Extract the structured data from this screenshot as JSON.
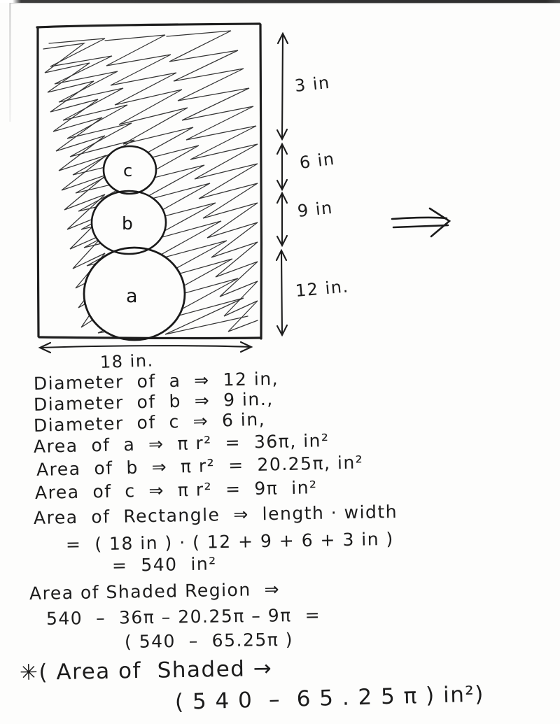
{
  "document": {
    "kind": "handwritten-geometry-worksheet",
    "ink_color": "#1c1c1c",
    "paper_color": "#fdfdfc"
  },
  "diagram": {
    "name": "shaded-rectangle-with-three-circles",
    "rectangle": {
      "label_width": "18 in.",
      "shaded": true
    },
    "circles": [
      {
        "id": "c",
        "label": "c",
        "position": "top",
        "diameter_in": 6
      },
      {
        "id": "b",
        "label": "b",
        "position": "middle",
        "diameter_in": 9
      },
      {
        "id": "a",
        "label": "a",
        "position": "bottom",
        "diameter_in": 12
      }
    ],
    "vertical_dimensions": [
      {
        "label": "3 in",
        "segment": "top-gap"
      },
      {
        "label": "6 in",
        "segment": "circle-c"
      },
      {
        "label": "9 in",
        "segment": "circle-b"
      },
      {
        "label": "12 in.",
        "segment": "circle-a"
      }
    ],
    "side_arrow": "⇒"
  },
  "work": {
    "lines": [
      {
        "id": "diam-a",
        "text": "Diameter  of  a  ⇒  12 in,"
      },
      {
        "id": "diam-b",
        "text": "Diameter  of  b  ⇒  9 in.,"
      },
      {
        "id": "diam-c",
        "text": "Diameter  of  c  ⇒  6 in,"
      },
      {
        "id": "area-a",
        "text": "Area  of  a  ⇒  π r²  =  36π, in²"
      },
      {
        "id": "area-b",
        "text": "Area  of  b  ⇒  π r²  =  20.25π, in²"
      },
      {
        "id": "area-c",
        "text": "Area  of  c  ⇒  π r²  =  9π  in²"
      },
      {
        "id": "area-rect",
        "text": "Area  of  Rectangle  ⇒  length · width"
      },
      {
        "id": "area-rect-sub",
        "text": "=  ( 18 in ) · ( 12 + 9 + 6 + 3 in )"
      },
      {
        "id": "area-rect-val",
        "text": "=  540  in²"
      },
      {
        "id": "shaded-head",
        "text": "Area of Shaded Region  ⇒"
      },
      {
        "id": "shaded-sub",
        "text": "540  –  36π – 20.25π – 9π  ="
      },
      {
        "id": "shaded-val",
        "text": "( 540  –  65.25π )"
      },
      {
        "id": "final-head",
        "text": "✳( Area of  Shaded →"
      },
      {
        "id": "final-val",
        "text": "( 5 4 0  –  6 5 . 2 5 π ) in²)"
      }
    ]
  }
}
